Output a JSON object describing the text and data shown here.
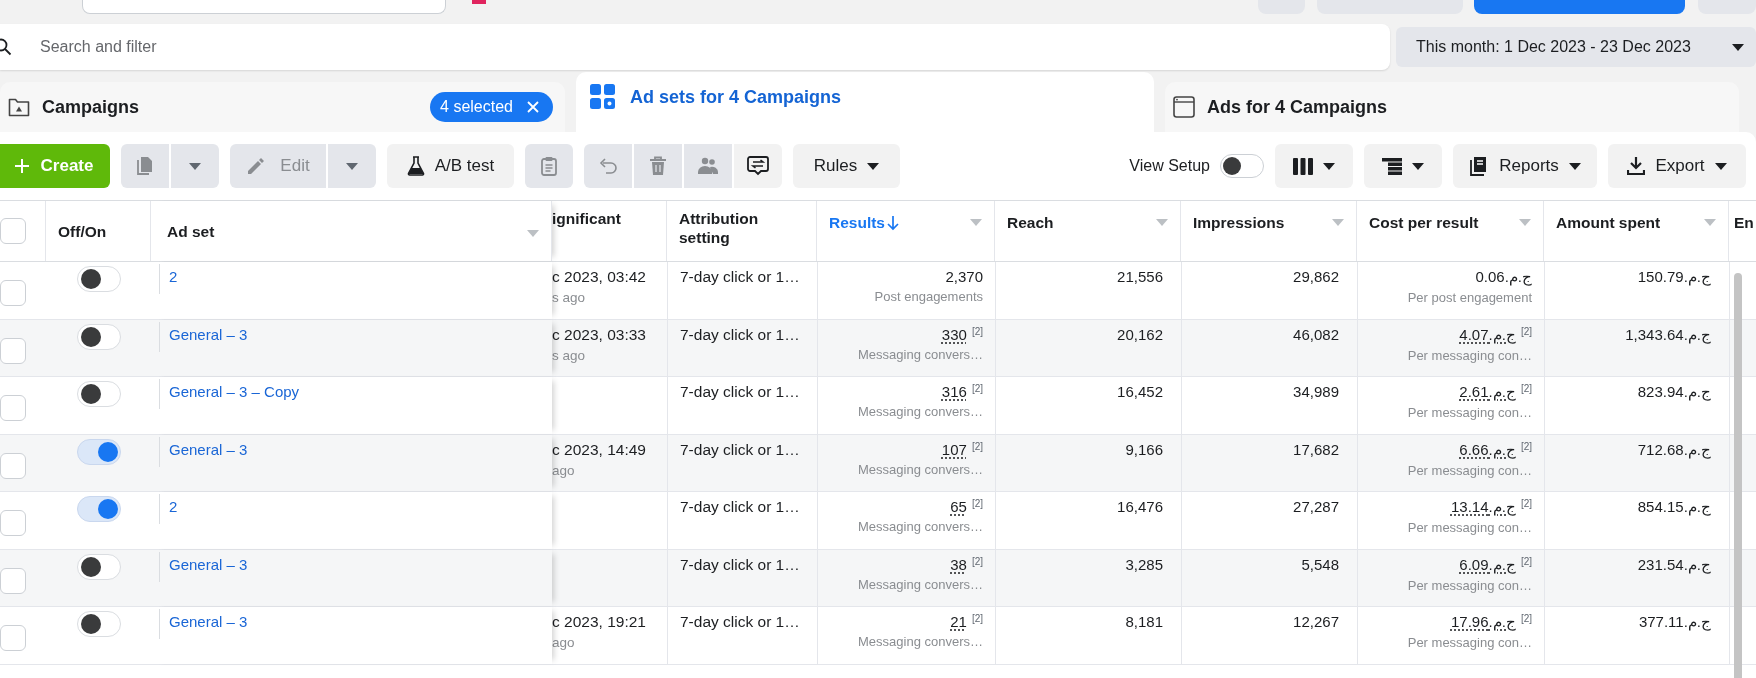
{
  "search": {
    "placeholder": "Search and filter"
  },
  "date_range": {
    "label": "This month: 1 Dec 2023 - 23 Dec 2023"
  },
  "tabs": [
    {
      "kind": "campaigns",
      "label": "Campaigns",
      "selected": false,
      "badge": "4 selected"
    },
    {
      "kind": "adsets",
      "label": "Ad sets for 4 Campaigns",
      "selected": true
    },
    {
      "kind": "ads",
      "label": "Ads for 4 Campaigns",
      "selected": false
    }
  ],
  "toolbar": {
    "left": [
      [
        {
          "kind": "create",
          "label": "Create",
          "disabled": false
        }
      ],
      [
        {
          "kind": "duplicate",
          "disabled": true
        },
        {
          "kind": "caret",
          "disabled": true
        }
      ],
      [
        {
          "kind": "edit",
          "label": "Edit",
          "disabled": true
        },
        {
          "kind": "caret",
          "disabled": true
        }
      ],
      [
        {
          "kind": "ab-test",
          "label": "A/B test",
          "disabled": false
        }
      ],
      [
        {
          "kind": "clipboard",
          "disabled": true
        }
      ],
      [
        {
          "kind": "undo",
          "disabled": true
        },
        {
          "kind": "delete",
          "disabled": true
        },
        {
          "kind": "people",
          "disabled": true
        },
        {
          "kind": "transfer",
          "disabled": false
        }
      ],
      [
        {
          "kind": "rules",
          "label": "Rules",
          "disabled": false
        }
      ]
    ],
    "view_setup": {
      "label": "View Setup",
      "on": false
    },
    "right": [
      {
        "kind": "columns"
      },
      {
        "kind": "breakdown"
      },
      {
        "kind": "reports",
        "label": "Reports"
      },
      {
        "kind": "export",
        "label": "Export"
      }
    ]
  },
  "table": {
    "select_all": {
      "checked": false
    },
    "columns": [
      {
        "label": "Off/On",
        "kind": "toggle",
        "menu": false,
        "sorted": false
      },
      {
        "label": "Ad set",
        "kind": "link",
        "menu": true,
        "sorted": false
      },
      {
        "label": "ignificant",
        "kind": "noted",
        "menu": false,
        "sorted": false
      },
      {
        "label": "Attribution setting",
        "kind": "text",
        "menu": false,
        "sorted": false
      },
      {
        "label": "Results",
        "kind": "metric",
        "menu": true,
        "sorted": true
      },
      {
        "label": "Reach",
        "kind": "number",
        "menu": true,
        "sorted": false
      },
      {
        "label": "Impressions",
        "kind": "number",
        "menu": true,
        "sorted": false
      },
      {
        "label": "Cost per result",
        "kind": "metric",
        "menu": true,
        "sorted": false
      },
      {
        "label": "Amount spent",
        "kind": "number",
        "menu": true,
        "sorted": false
      },
      {
        "label": "En",
        "kind": "number",
        "menu": false,
        "sorted": false
      }
    ],
    "rows": [
      {
        "selected": false,
        "on": false,
        "ad_set": "2",
        "column_3": {
          "value": "c 2023, 03:42",
          "note": "s ago"
        },
        "attribution": "7-day click or 1…",
        "results": {
          "value": "2,370",
          "note": "Post engagements"
        },
        "reach": "21,556",
        "impressions": "29,862",
        "cost_per_result": {
          "value": "ج.م.0.06",
          "note": "Per post engagement"
        },
        "amount_spent": "ج.م.150.79"
      },
      {
        "selected": false,
        "on": false,
        "ad_set": "General – 3",
        "column_3": {
          "value": "c 2023, 03:33",
          "note": "s ago"
        },
        "attribution": "7-day click or 1…",
        "results": {
          "value": "330",
          "ref": "[2]",
          "note": "Messaging convers…"
        },
        "reach": "20,162",
        "impressions": "46,082",
        "cost_per_result": {
          "value": "ج.م.4.07",
          "ref": "[2]",
          "note": "Per messaging con…"
        },
        "amount_spent": "ج.م.1,343.64"
      },
      {
        "selected": false,
        "on": false,
        "ad_set": "General – 3 – Copy",
        "attribution": "7-day click or 1…",
        "results": {
          "value": "316",
          "ref": "[2]",
          "note": "Messaging convers…"
        },
        "reach": "16,452",
        "impressions": "34,989",
        "cost_per_result": {
          "value": "ج.م.2.61",
          "ref": "[2]",
          "note": "Per messaging con…"
        },
        "amount_spent": "ج.م.823.94"
      },
      {
        "selected": false,
        "on": true,
        "ad_set": "General – 3",
        "column_3": {
          "value": "c 2023, 14:49",
          "note": "ago"
        },
        "attribution": "7-day click or 1…",
        "results": {
          "value": "107",
          "ref": "[2]",
          "note": "Messaging convers…"
        },
        "reach": "9,166",
        "impressions": "17,682",
        "cost_per_result": {
          "value": "ج.م.6.66",
          "ref": "[2]",
          "note": "Per messaging con…"
        },
        "amount_spent": "ج.م.712.68"
      },
      {
        "selected": false,
        "on": true,
        "ad_set": "2",
        "attribution": "7-day click or 1…",
        "results": {
          "value": "65",
          "ref": "[2]",
          "note": "Messaging convers…"
        },
        "reach": "16,476",
        "impressions": "27,287",
        "cost_per_result": {
          "value": "ج.م.13.14",
          "ref": "[2]",
          "note": "Per messaging con…"
        },
        "amount_spent": "ج.م.854.15"
      },
      {
        "selected": false,
        "on": false,
        "ad_set": "General – 3",
        "attribution": "7-day click or 1…",
        "results": {
          "value": "38",
          "ref": "[2]",
          "note": "Messaging convers…"
        },
        "reach": "3,285",
        "impressions": "5,548",
        "cost_per_result": {
          "value": "ج.م.6.09",
          "ref": "[2]",
          "note": "Per messaging con…"
        },
        "amount_spent": "ج.م.231.54"
      },
      {
        "selected": false,
        "on": false,
        "ad_set": "General – 3",
        "column_3": {
          "value": "c 2023, 19:21",
          "note": "ago"
        },
        "attribution": "7-day click or 1…",
        "results": {
          "value": "21",
          "ref": "[2]",
          "note": "Messaging convers…"
        },
        "reach": "8,181",
        "impressions": "12,267",
        "cost_per_result": {
          "value": "ج.م.17.96",
          "ref": "[2]",
          "note": "Per messaging con…"
        },
        "amount_spent": "ج.م.377.11"
      }
    ]
  }
}
